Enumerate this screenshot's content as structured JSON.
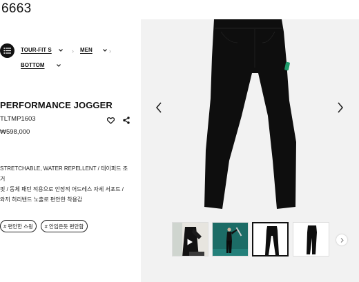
{
  "page_code": "6663",
  "breadcrumb": {
    "items": [
      {
        "label": "TOUR-FIT S"
      },
      {
        "label": "MEN"
      },
      {
        "label": "BOTTOM"
      }
    ]
  },
  "product": {
    "name": "PERFORMANCE JOGGER",
    "sku": "TLTMP1603",
    "price": "₩598,000",
    "description": [
      "STRETCHABLE, WATER REPELLENT / 테이퍼드 조거",
      "핏 / 동체 패턴 적용으로 안정적 어드레스 자세 서포트 /",
      "와끼 허리밴드 노출로 편안한 착용감"
    ],
    "tags": [
      "# 편안한 스윙",
      "# 안입은듯 편안함"
    ]
  },
  "gallery": {
    "thumbnails": [
      {
        "icon": "play-icon",
        "kind": "video"
      },
      {
        "kind": "model"
      },
      {
        "kind": "front",
        "selected": true
      },
      {
        "kind": "side"
      }
    ]
  },
  "colors": {
    "garment": "#0e0e0e",
    "accent_tag": "#1f9a6b",
    "gallery_bg": "#f2f2f2",
    "thumb_teal": "#1c6c66"
  }
}
